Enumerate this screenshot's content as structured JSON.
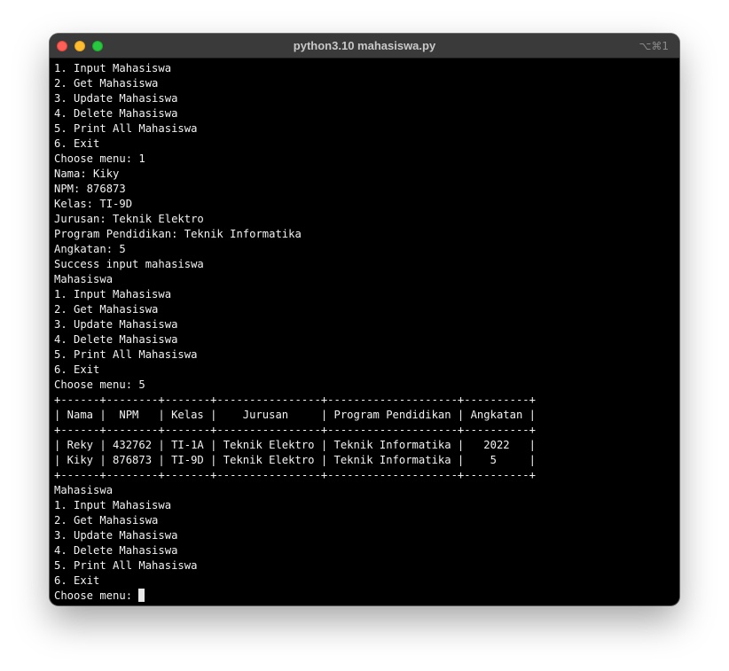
{
  "window": {
    "title": "python3.10 mahasiswa.py",
    "shortcut": "⌥⌘1"
  },
  "terminal": {
    "lines": [
      "1. Input Mahasiswa",
      "2. Get Mahasiswa",
      "3. Update Mahasiswa",
      "4. Delete Mahasiswa",
      "5. Print All Mahasiswa",
      "6. Exit",
      "Choose menu: 1",
      "Nama: Kiky",
      "NPM: 876873",
      "Kelas: TI-9D",
      "Jurusan: Teknik Elektro",
      "Program Pendidikan: Teknik Informatika",
      "Angkatan: 5",
      "Success input mahasiswa",
      "Mahasiswa",
      "1. Input Mahasiswa",
      "2. Get Mahasiswa",
      "3. Update Mahasiswa",
      "4. Delete Mahasiswa",
      "5. Print All Mahasiswa",
      "6. Exit",
      "Choose menu: 5",
      "+------+--------+-------+----------------+--------------------+----------+",
      "| Nama |  NPM   | Kelas |    Jurusan     | Program Pendidikan | Angkatan |",
      "+------+--------+-------+----------------+--------------------+----------+",
      "| Reky | 432762 | TI-1A | Teknik Elektro | Teknik Informatika |   2022   |",
      "| Kiky | 876873 | TI-9D | Teknik Elektro | Teknik Informatika |    5     |",
      "+------+--------+-------+----------------+--------------------+----------+",
      "Mahasiswa",
      "1. Input Mahasiswa",
      "2. Get Mahasiswa",
      "3. Update Mahasiswa",
      "4. Delete Mahasiswa",
      "5. Print All Mahasiswa",
      "6. Exit"
    ],
    "prompt": "Choose menu: "
  }
}
